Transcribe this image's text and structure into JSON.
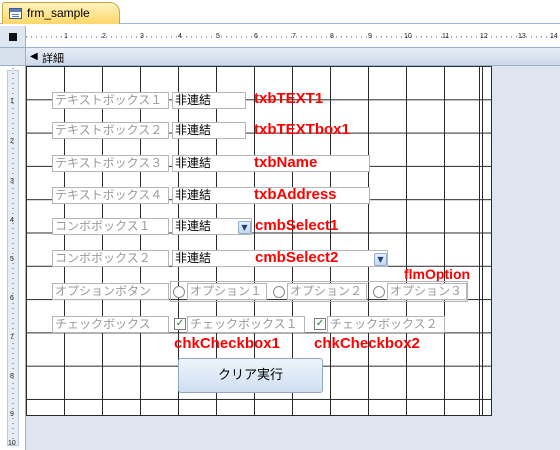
{
  "tab": {
    "label": "frm_sample",
    "icon": "form-icon"
  },
  "section": {
    "label": "詳細",
    "icon": "section-collapse-arrow-icon"
  },
  "h_ruler": {
    "numbers": [
      "1",
      "2",
      "3",
      "4",
      "5",
      "6",
      "7",
      "8",
      "9",
      "10",
      "11",
      "12",
      "13",
      "14"
    ]
  },
  "v_ruler": {
    "numbers": [
      "1",
      "2",
      "3",
      "4",
      "5",
      "6",
      "7",
      "8",
      "9",
      "10"
    ]
  },
  "rows": {
    "text1": {
      "label": "テキストボックス１",
      "value": "非連結",
      "annotation": "txbTEXT1"
    },
    "text2": {
      "label": "テキストボックス２",
      "value": "非連結",
      "annotation": "txbTEXTbox1"
    },
    "text3": {
      "label": "テキストボックス３",
      "value": "非連結",
      "annotation": "txbName"
    },
    "text4": {
      "label": "テキストボックス４",
      "value": "非連結",
      "annotation": "txbAddress"
    },
    "combo1": {
      "label": "コンボボックス１",
      "value": "非連結",
      "annotation": "cmbSelect1"
    },
    "combo2": {
      "label": "コンボボックス２",
      "value": "非連結",
      "annotation": "cmbSelect2"
    },
    "option": {
      "label": "オプションボタン",
      "annotation": "flmOption",
      "opt1": "オプション１",
      "opt2": "オプション２",
      "opt3": "オプション３"
    },
    "check": {
      "label": "チェックボックス",
      "check1": "チェックボックス１",
      "check2": "チェックボックス２",
      "annotation1": "chkCheckbox1",
      "annotation2": "chkCheckbox2"
    }
  },
  "button": {
    "label": "クリア実行"
  },
  "colors": {
    "annotation": "#ff0000",
    "tab": "#ffd767",
    "grid_line": "#2a2a2a"
  }
}
